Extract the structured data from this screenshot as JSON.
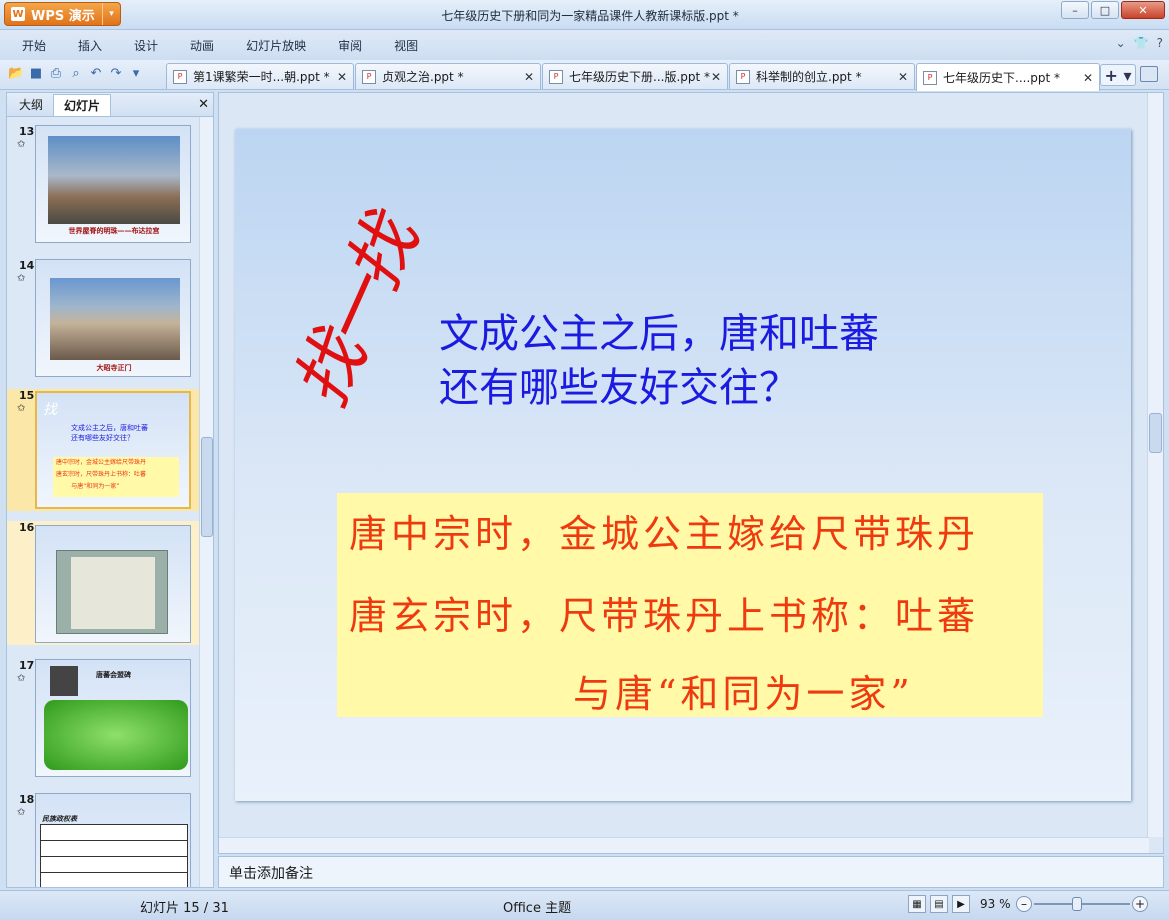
{
  "app": {
    "button_label": "WPS 演示",
    "window_title": "七年级历史下册和同为一家精品课件人教新课标版.ppt *"
  },
  "menu": [
    "开始",
    "插入",
    "设计",
    "动画",
    "幻灯片放映",
    "审阅",
    "视图"
  ],
  "tabs": [
    {
      "label": "第1课繁荣一时...朝.ppt *"
    },
    {
      "label": "贞观之治.ppt *"
    },
    {
      "label": "七年级历史下册...版.ppt *"
    },
    {
      "label": "科举制的创立.ppt *"
    },
    {
      "label": "七年级历史下....ppt *"
    }
  ],
  "sidebar": {
    "tab_outline": "大纲",
    "tab_slides": "幻灯片",
    "thumbs": [
      {
        "num": "13",
        "caption": "世界屋脊的明珠——布达拉宫"
      },
      {
        "num": "14",
        "caption": "大昭寺正门"
      },
      {
        "num": "15",
        "caption": ""
      },
      {
        "num": "16",
        "caption": ""
      },
      {
        "num": "17",
        "caption": "唐蕃会盟碑"
      },
      {
        "num": "18",
        "caption": "民族政权表"
      }
    ]
  },
  "slide": {
    "find": "找一找",
    "question_line1": "文成公主之后，唐和吐蕃",
    "question_line2": "还有哪些友好交往？",
    "answer_line1": "唐中宗时，金城公主嫁给尺带珠丹",
    "answer_line2": "唐玄宗时，尺带珠丹上书称：吐蕃",
    "answer_line3": "与唐“和同为一家”"
  },
  "notes_placeholder": "单击添加备注",
  "status": {
    "slide_counter": "幻灯片 15 / 31",
    "theme": "Office 主题",
    "zoom": "93 %"
  }
}
